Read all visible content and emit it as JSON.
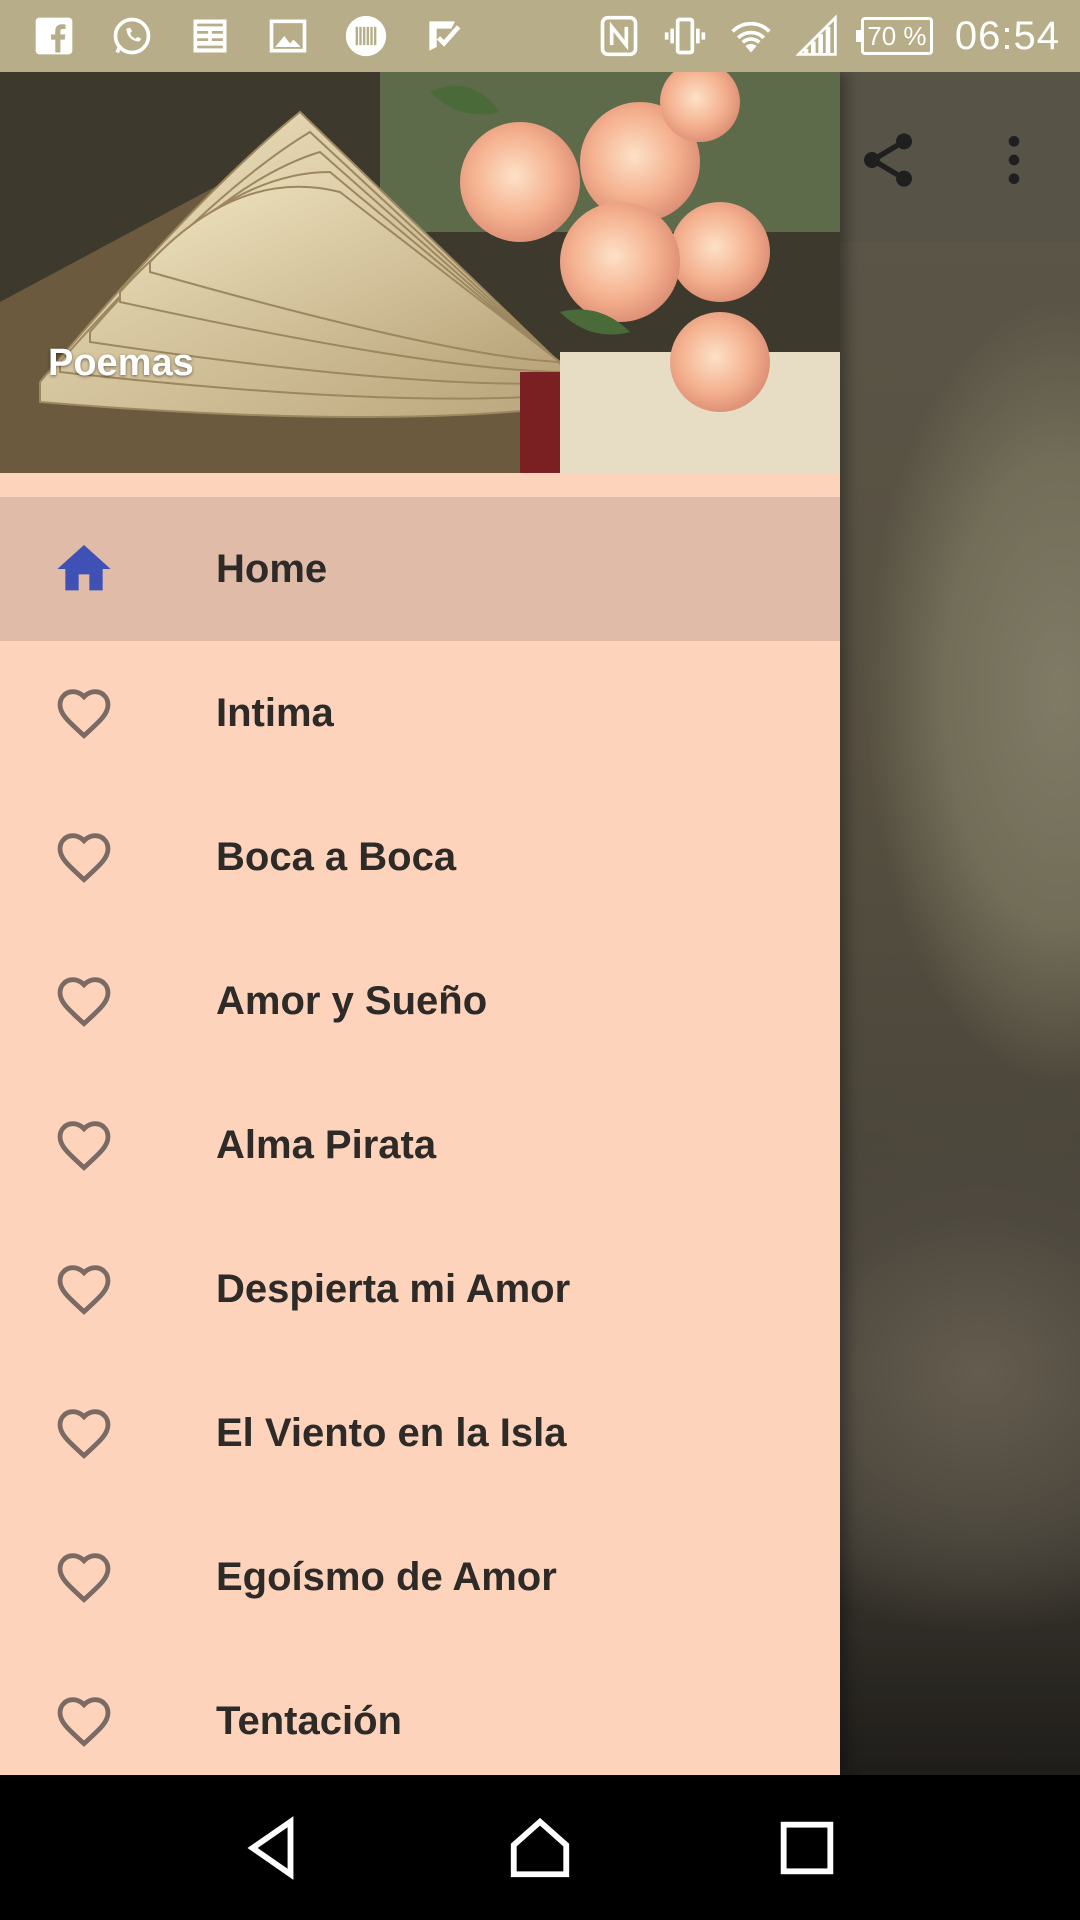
{
  "status_bar": {
    "time": "06:54",
    "battery": "70 %",
    "left_icons": [
      "facebook-icon",
      "whatsapp-icon",
      "news-icon",
      "gallery-icon",
      "barcode-icon",
      "check-icon"
    ],
    "right_icons": [
      "nfc-icon",
      "vibrate-icon",
      "wifi-icon",
      "signal-icon"
    ]
  },
  "drawer": {
    "title": "Poemas",
    "items": [
      {
        "label": "Home",
        "icon": "home-icon",
        "active": true
      },
      {
        "label": "Intima",
        "icon": "heart-icon"
      },
      {
        "label": "Boca a Boca",
        "icon": "heart-icon"
      },
      {
        "label": "Amor y Sueño",
        "icon": "heart-icon"
      },
      {
        "label": "Alma Pirata",
        "icon": "heart-icon"
      },
      {
        "label": "Despierta mi Amor",
        "icon": "heart-icon"
      },
      {
        "label": "El Viento en la Isla",
        "icon": "heart-icon"
      },
      {
        "label": "Egoísmo de Amor",
        "icon": "heart-icon"
      },
      {
        "label": "Tentación",
        "icon": "heart-icon"
      }
    ]
  },
  "toolbar_actions": [
    "share-icon",
    "overflow-menu-icon"
  ],
  "nav_bar": [
    "back-icon",
    "home-nav-icon",
    "recents-icon"
  ],
  "colors": {
    "status_bar": "#b7ad89",
    "drawer_bg": "#fdd3bc",
    "active_item_bg": "#e0bba8",
    "home_icon": "#3f51b5",
    "heart_icon": "#7a6a63",
    "label_text": "#2d2a28"
  }
}
